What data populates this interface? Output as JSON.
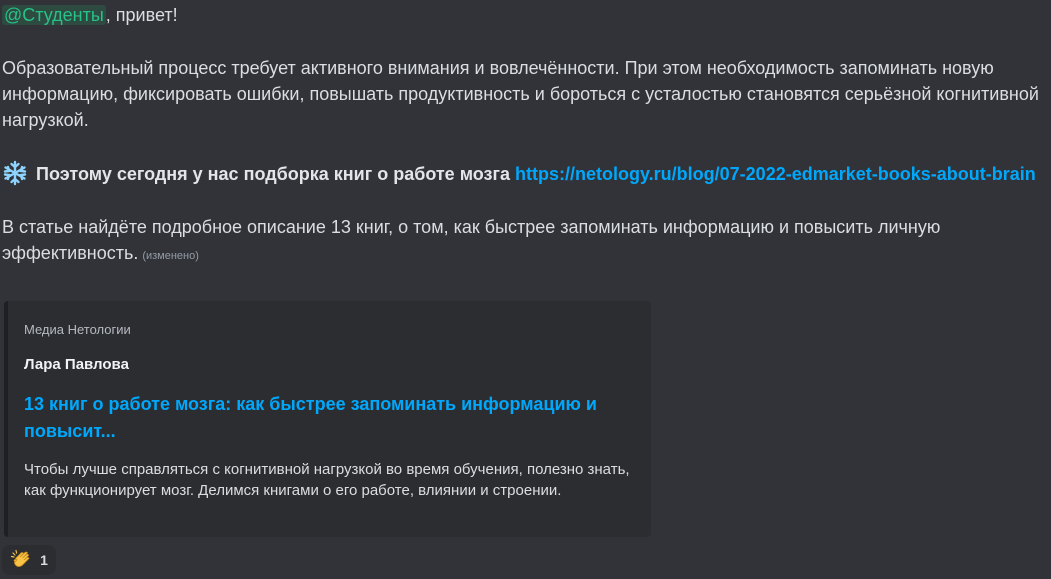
{
  "message": {
    "mention": "@Студенты",
    "greeting_rest": ", привет!",
    "paragraph1": "Образовательный процесс требует активного внимания и вовлечённости. При этом необходимость запоминать новую информацию, фиксировать ошибки, повышать продуктивность и бороться с усталостью становятся серьёзной когнитивной нагрузкой.",
    "snowflake_icon": "snowflake-icon",
    "paragraph2_bold": "Поэтому сегодня у нас подборка книг о работе мозга",
    "link": "https://netology.ru/blog/07-2022-edmarket-books-about-brain",
    "paragraph3": "В статье найдёте подробное описание 13 книг, о том, как быстрее запоминать информацию и повысить личную эффективность.",
    "edited": "(изменено)"
  },
  "embed": {
    "provider": "Медиа Нетологии",
    "author": "Лара Павлова",
    "title": "13 книг о работе мозга: как быстрее запоминать информацию и повысит...",
    "description": "Чтобы лучше справляться с когнитивной нагрузкой во время обучения, полезно знать, как функционирует мозг. Делимся книгами о его работе, влиянии и строении."
  },
  "reaction": {
    "emoji": "clapping-hands-icon",
    "count": "1"
  },
  "colors": {
    "background": "#313338",
    "link": "#00a8fc",
    "mention": "#27c289",
    "embed_bg": "#2b2d31"
  }
}
